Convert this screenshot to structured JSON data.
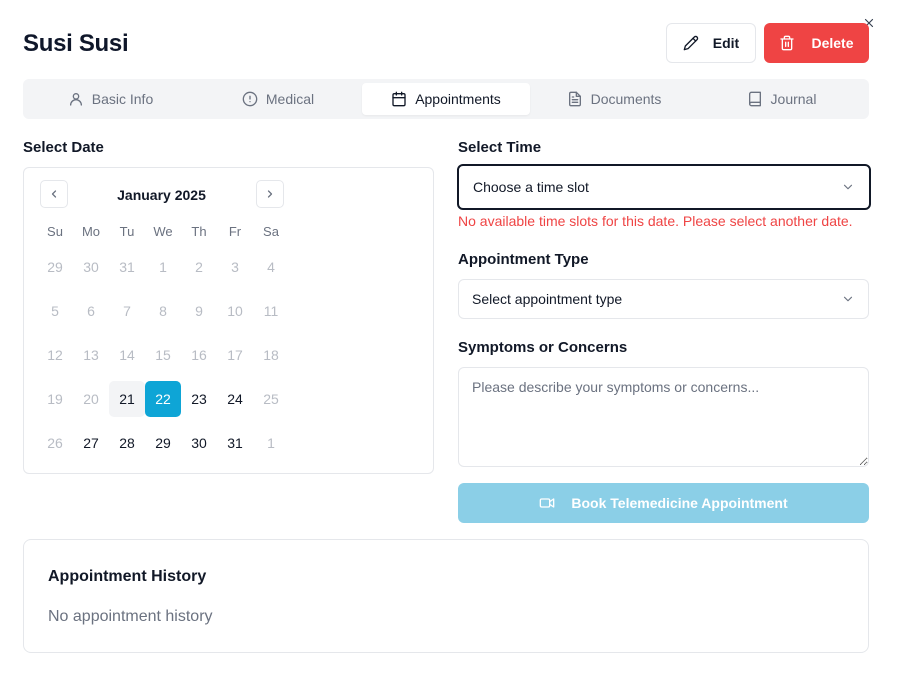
{
  "patient": {
    "name": "Susi Susi"
  },
  "actions": {
    "edit_label": "Edit",
    "delete_label": "Delete",
    "delete_color": "#ef4444"
  },
  "tabs": [
    {
      "label": "Basic Info",
      "icon": "user-icon"
    },
    {
      "label": "Medical",
      "icon": "alert-circle-icon"
    },
    {
      "label": "Appointments",
      "icon": "calendar-icon",
      "active": true
    },
    {
      "label": "Documents",
      "icon": "file-text-icon"
    },
    {
      "label": "Journal",
      "icon": "book-icon"
    }
  ],
  "date_section": {
    "label": "Select Date"
  },
  "calendar": {
    "month_label": "January 2025",
    "weekdays": [
      "Su",
      "Mo",
      "Tu",
      "We",
      "Th",
      "Fr",
      "Sa"
    ],
    "weeks": [
      [
        "29",
        "30",
        "31",
        "1",
        "2",
        "3",
        "4"
      ],
      [
        "5",
        "6",
        "7",
        "8",
        "9",
        "10",
        "11"
      ],
      [
        "12",
        "13",
        "14",
        "15",
        "16",
        "17",
        "18"
      ],
      [
        "19",
        "20",
        "21",
        "22",
        "23",
        "24",
        "25"
      ],
      [
        "26",
        "27",
        "28",
        "29",
        "30",
        "31",
        "1"
      ]
    ],
    "enabled_days": [
      "21",
      "22",
      "23",
      "24",
      "27",
      "28",
      "29",
      "30",
      "31"
    ],
    "today": "21",
    "selected": "22",
    "accent_color": "#0ea5d6"
  },
  "time_section": {
    "label": "Select Time",
    "placeholder": "Choose a time slot",
    "error": "No available time slots for this date. Please select another date."
  },
  "type_section": {
    "label": "Appointment Type",
    "placeholder": "Select appointment type"
  },
  "symptoms_section": {
    "label": "Symptoms or Concerns",
    "placeholder": "Please describe your symptoms or concerns..."
  },
  "book_button": {
    "label": "Book Telemedicine Appointment",
    "color": "#8bcfe7"
  },
  "history": {
    "title": "Appointment History",
    "empty_text": "No appointment history"
  }
}
